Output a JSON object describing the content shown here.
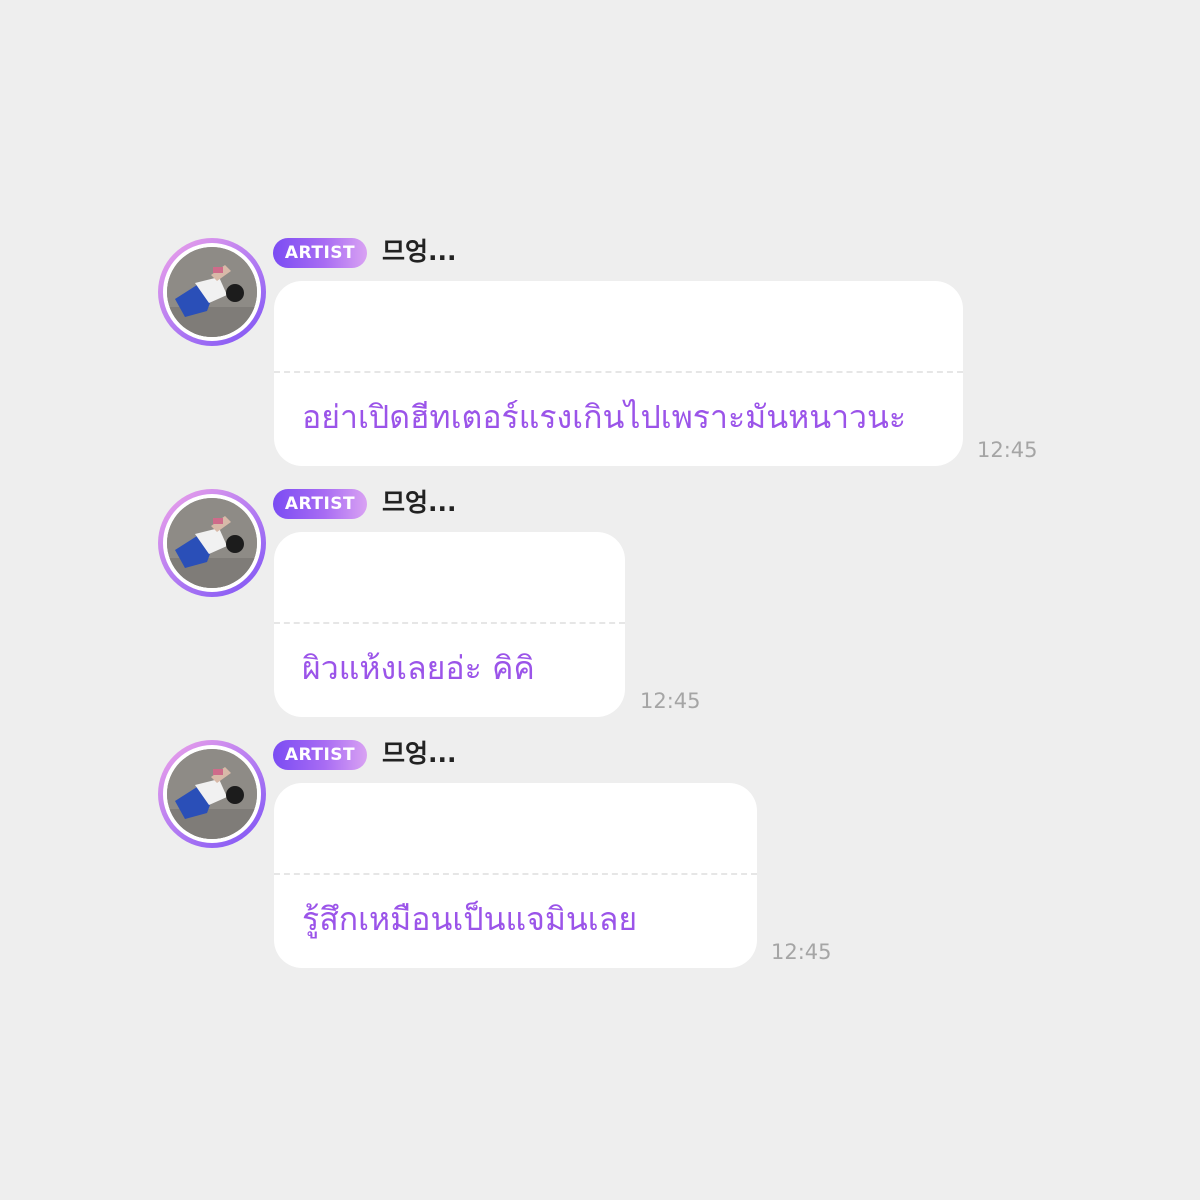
{
  "messages": [
    {
      "badge": "ARTIST",
      "sender": "므엉...",
      "text": "อย่าเปิดฮีทเตอร์แรงเกินไปเพราะมันหนาวนะ",
      "time": "12:45"
    },
    {
      "badge": "ARTIST",
      "sender": "므엉...",
      "text": "ผิวแห้งเลยอ่ะ คิคิ",
      "time": "12:45"
    },
    {
      "badge": "ARTIST",
      "sender": "므엉...",
      "text": "รู้สึกเหมือนเป็นแจมินเลย",
      "time": "12:45"
    }
  ],
  "colors": {
    "background": "#eeeeee",
    "bubble": "#ffffff",
    "message_text": "#9b54e9",
    "badge_gradient_start": "#7b4cf3",
    "badge_gradient_end": "#d9a2f3",
    "timestamp": "#a5a5a5"
  }
}
